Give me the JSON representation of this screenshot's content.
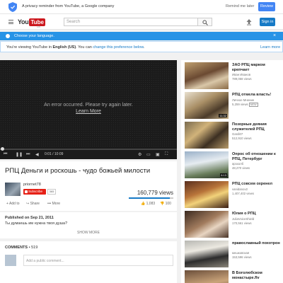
{
  "reminder": {
    "text": "A privacy reminder from YouTube, a Google company",
    "later": "Remind me later",
    "review": "Review"
  },
  "masthead": {
    "logo_you": "You",
    "logo_tube": "Tube",
    "logo_country": "UA",
    "search_placeholder": "Search",
    "signin": "Sign in"
  },
  "langbar": {
    "text": "Choose your language."
  },
  "notice": {
    "prefix": "You're viewing YouTube in ",
    "language": "English (US)",
    "middle": ". You can ",
    "link": "change this preference below",
    "end": ".",
    "learn_more": "Learn more"
  },
  "player": {
    "error": "An error occurred. Please try again later.",
    "learn_more": "Learn More",
    "time": "0:01 / 10:09"
  },
  "video": {
    "title": "РПЦ Деньги и роскошь - чудо божьей милости",
    "channel": "priornet78",
    "subscribe": "Subscribe",
    "sub_count": "365",
    "views": "160,779 views",
    "add_to": "Add to",
    "share": "Share",
    "more": "More",
    "likes": "1,083",
    "dislikes": "100"
  },
  "description": {
    "published": "Published on Sep 21, 2011",
    "text": "Ты думаешь им нужна твоя душа?",
    "show_more": "SHOW MORE"
  },
  "comments": {
    "label": "COMMENTS",
    "count": "519",
    "placeholder": "Add a public comment..."
  },
  "recommended": [
    {
      "title": "ЗАО РПЦ марком крепчает",
      "author": "Иван Иванов",
      "views": "789,058 views",
      "badge": "",
      "duration": ""
    },
    {
      "title": "РПЦ отмела власть!",
      "author": "Личное Мнение",
      "views": "5,259 views",
      "badge": "NEW",
      "duration": "11:32"
    },
    {
      "title": "Позорные деяния служителей РПЦ",
      "author": "Gardi07",
      "views": "512,910 views",
      "badge": "",
      "duration": ""
    },
    {
      "title": "Опрос об отношении к РПЦ, Петербург",
      "author": "арзхолб",
      "views": "48,270 views",
      "badge": "",
      "duration": "6:13"
    },
    {
      "title": "РПЦ совсем охренел",
      "author": "vanidanov2",
      "views": "1,407,402 views",
      "badge": "",
      "duration": ""
    },
    {
      "title": "Юлия о РПЦ",
      "author": "JuliaVoiceShield",
      "views": "170,561 views",
      "badge": "",
      "duration": ""
    },
    {
      "title": "православный похотрон",
      "author": "мешковская",
      "views": "153,596 views",
      "badge": "",
      "duration": ""
    },
    {
      "title": "В Боголюбском монастыре.flv",
      "author": "",
      "views": "",
      "badge": "",
      "duration": ""
    }
  ],
  "colors": {
    "brand_red": "#cc181e",
    "link_blue": "#167ac6",
    "lang_bar": "#2793e6"
  }
}
